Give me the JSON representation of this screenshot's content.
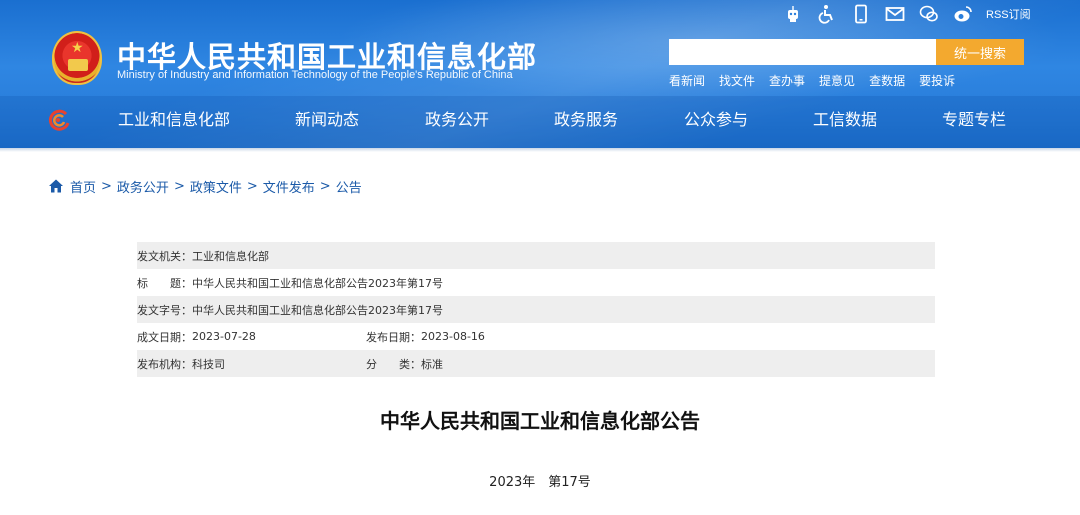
{
  "header": {
    "site_title": "中华人民共和国工业和信息化部",
    "site_subtitle": "Ministry of Industry and Information Technology of the People's Republic of China",
    "top_icons": [
      "robot-icon",
      "accessibility-icon",
      "mobile-icon",
      "mail-icon",
      "wechat-icon",
      "weibo-icon"
    ],
    "rss_label": "RSS订阅",
    "search": {
      "placeholder": "",
      "button_label": "统一搜索"
    },
    "quick_links": [
      "看新闻",
      "找文件",
      "查办事",
      "提意见",
      "查数据",
      "要投诉"
    ],
    "colors": {
      "header_blue": "#2a7fdc",
      "search_button": "#f3a92f"
    }
  },
  "nav": {
    "items": [
      "工业和信息化部",
      "新闻动态",
      "政务公开",
      "政务服务",
      "公众参与",
      "工信数据",
      "专题专栏"
    ]
  },
  "breadcrumb": {
    "items": [
      "首页",
      "政务公开",
      "政策文件",
      "文件发布",
      "公告"
    ],
    "separator": ">"
  },
  "metadata": {
    "issuer_label": "发文机关：",
    "issuer": "工业和信息化部",
    "title_label": "标　　题：",
    "title": "中华人民共和国工业和信息化部公告2023年第17号",
    "doc_no_label": "发文字号：",
    "doc_no": "中华人民共和国工业和信息化部公告2023年第17号",
    "created_label": "成文日期：",
    "created": "2023-07-28",
    "published_label": "发布日期：",
    "published": "2023-08-16",
    "org_label": "发布机构：",
    "org": "科技司",
    "category_label": "分　　类：",
    "category": "标准"
  },
  "document": {
    "title": "中华人民共和国工业和信息化部公告",
    "number": "2023年　第17号"
  }
}
